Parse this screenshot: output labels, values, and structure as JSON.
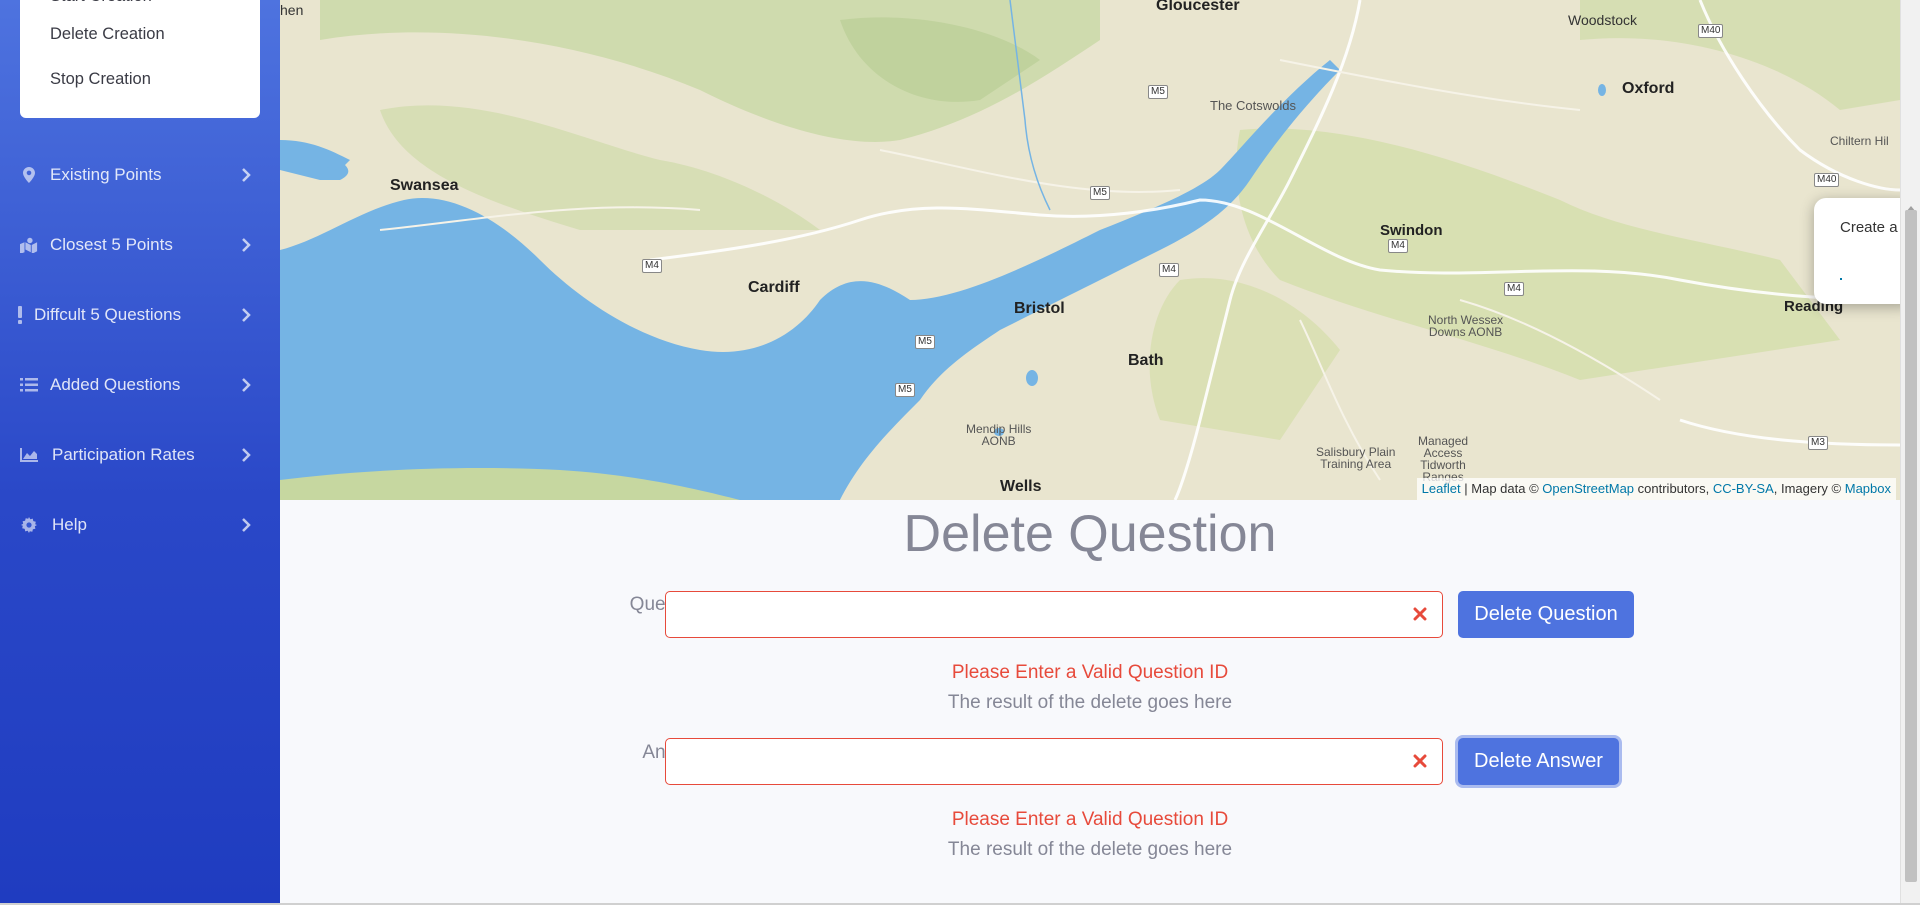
{
  "sidebar": {
    "submenu": {
      "items": [
        {
          "label": "Start Creation"
        },
        {
          "label": "Delete Creation"
        },
        {
          "label": "Stop Creation"
        }
      ]
    },
    "nav": [
      {
        "label": "Existing Points",
        "icon": "map-marker-icon"
      },
      {
        "label": "Closest 5 Points",
        "icon": "map-marked-icon"
      },
      {
        "label": "Diffcult 5 Questions",
        "icon": "exclamation-icon"
      },
      {
        "label": "Added Questions",
        "icon": "list-icon"
      },
      {
        "label": "Participation Rates",
        "icon": "area-chart-icon"
      },
      {
        "label": "Help",
        "icon": "gear-icon"
      }
    ]
  },
  "map": {
    "places": {
      "gloucester": "Gloucester",
      "woodstock": "Woodstock",
      "oxford": "Oxford",
      "the_cotswolds": "The Cotswolds",
      "swansea": "Swansea",
      "swindon": "Swindon",
      "cardiff": "Cardiff",
      "bristol": "Bristol",
      "bath": "Bath",
      "reading": "Reading",
      "wells": "Wells",
      "chiltern": "Chiltern Hil",
      "north_wessex": "North Wessex\nDowns AONB",
      "mendip": "Mendip Hills\nAONB",
      "salisbury": "Salisbury Plain\nTraining Area",
      "managed": "Managed\nAccess\nTidworth\nRanges",
      "hen": "hen"
    },
    "roads": {
      "m40a": "M40",
      "m40b": "M40",
      "m5a": "M5",
      "m5b": "M5",
      "m5c": "M5",
      "m5d": "M5",
      "m4a": "M4",
      "m4b": "M4",
      "m4c": "M4",
      "m4d": "M4",
      "m3": "M3"
    },
    "attribution": {
      "leaflet": "Leaflet",
      "text1": " | Map data © ",
      "osm": "OpenStreetMap",
      "text2": " contributors, ",
      "license": "CC-BY-SA",
      "text3": ", Imagery © ",
      "mapbox": "Mapbox"
    },
    "popup": {
      "text": "Create a"
    }
  },
  "main": {
    "title": "Delete Question",
    "question": {
      "label": "Question ID",
      "value": "",
      "button": "Delete Question",
      "error": "Please Enter a Valid Question ID",
      "result": "The result of the delete goes here"
    },
    "answer": {
      "label": "Answer ID",
      "value": "",
      "button": "Delete Answer",
      "error": "Please Enter a Valid Question ID",
      "result": "The result of the delete goes here"
    }
  },
  "colors": {
    "primary": "#4e73df",
    "danger": "#e74a3b",
    "muted": "#858796",
    "water": "#75b4e4",
    "land": "#e8e4cf"
  }
}
